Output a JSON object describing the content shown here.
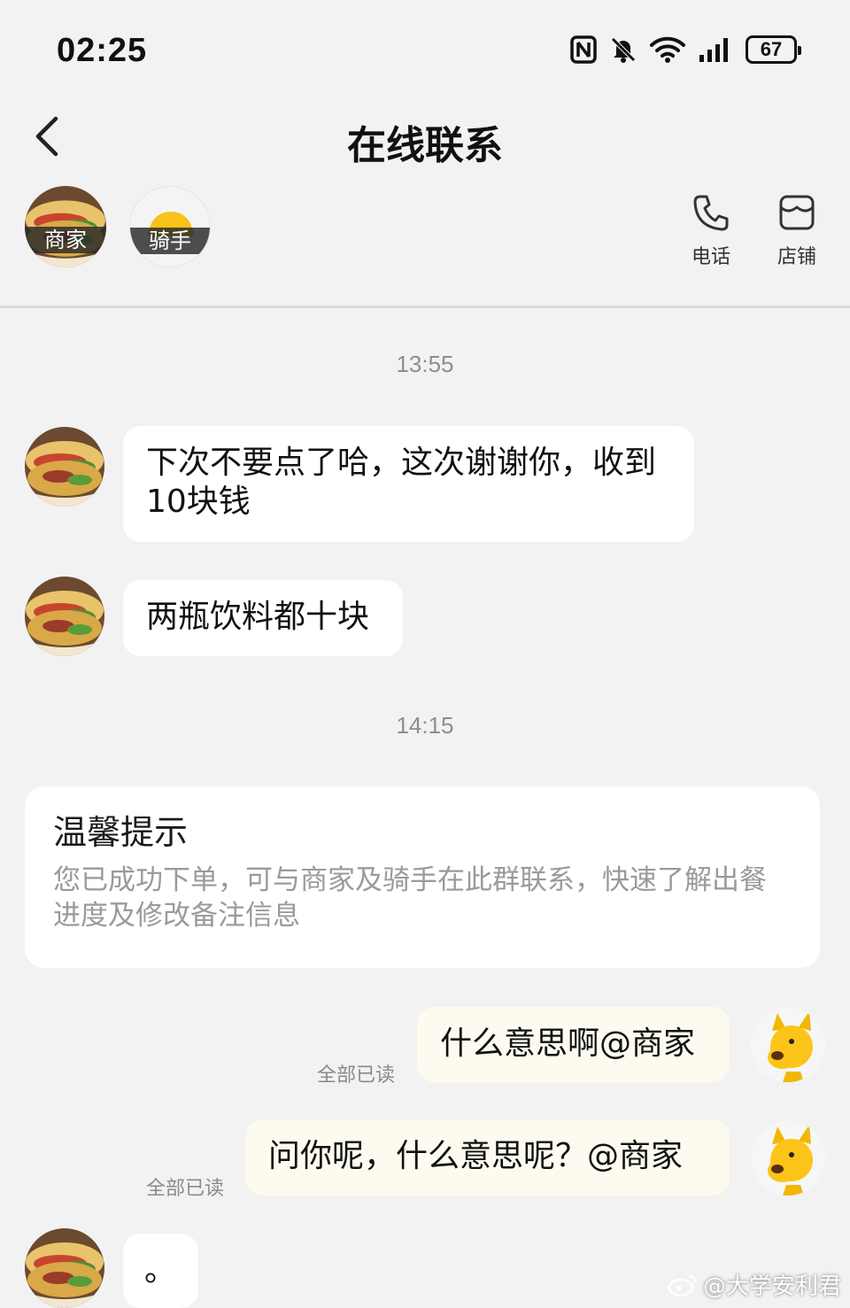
{
  "status_bar": {
    "time": "02:25",
    "battery": "67"
  },
  "nav": {
    "title": "在线联系"
  },
  "participants": [
    {
      "label": "商家"
    },
    {
      "label": "骑手"
    }
  ],
  "actions": {
    "phone_label": "电话",
    "shop_label": "店铺"
  },
  "chat": {
    "timestamps": [
      "13:55",
      "14:15"
    ],
    "messages": [
      {
        "text": "下次不要点了哈，这次谢谢你，收到10块钱"
      },
      {
        "text": "两瓶饮料都十块"
      },
      {
        "text": "什么意思啊@商家",
        "read": "全部已读"
      },
      {
        "text": "问你呢，什么意思呢？@商家",
        "read": "全部已读"
      },
      {
        "text": "。"
      }
    ],
    "notice": {
      "title": "温馨提示",
      "body": "您已成功下单，可与商家及骑手在此群联系，快速了解出餐进度及修改备注信息"
    }
  },
  "watermark": "@大学安利君",
  "colors": {
    "background": "#f2f2f2",
    "incoming_bubble": "#ffffff",
    "outgoing_bubble": "#fdfbef",
    "accent_yellow": "#f5c518"
  }
}
